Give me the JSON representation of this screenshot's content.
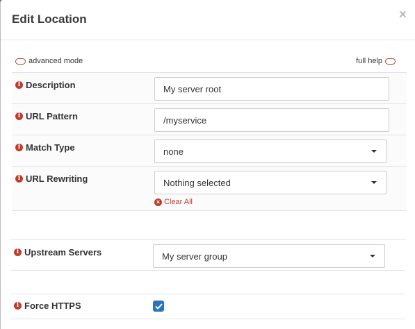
{
  "modal": {
    "title": "Edit Location",
    "close_glyph": "×"
  },
  "toggles": {
    "advanced_mode_label": "advanced mode",
    "full_help_label": "full help"
  },
  "fields": {
    "description": {
      "label": "Description",
      "value": "My server root"
    },
    "url_pattern": {
      "label": "URL Pattern",
      "value": "/myservice"
    },
    "match_type": {
      "label": "Match Type",
      "selected": "none"
    },
    "url_rewriting": {
      "label": "URL Rewriting",
      "selected": "Nothing selected",
      "clear_all": "Clear All"
    },
    "upstream_servers": {
      "label": "Upstream Servers",
      "selected": "My server group"
    },
    "force_https": {
      "label": "Force HTTPS",
      "checked": true
    }
  },
  "icons": {
    "info": "info-icon",
    "close": "close-icon",
    "dropdown": "caret-down-icon",
    "clear": "x-circle-icon",
    "check": "check-icon"
  },
  "colors": {
    "accent_red": "#c03b2b",
    "checkbox_blue": "#2a74b8"
  }
}
